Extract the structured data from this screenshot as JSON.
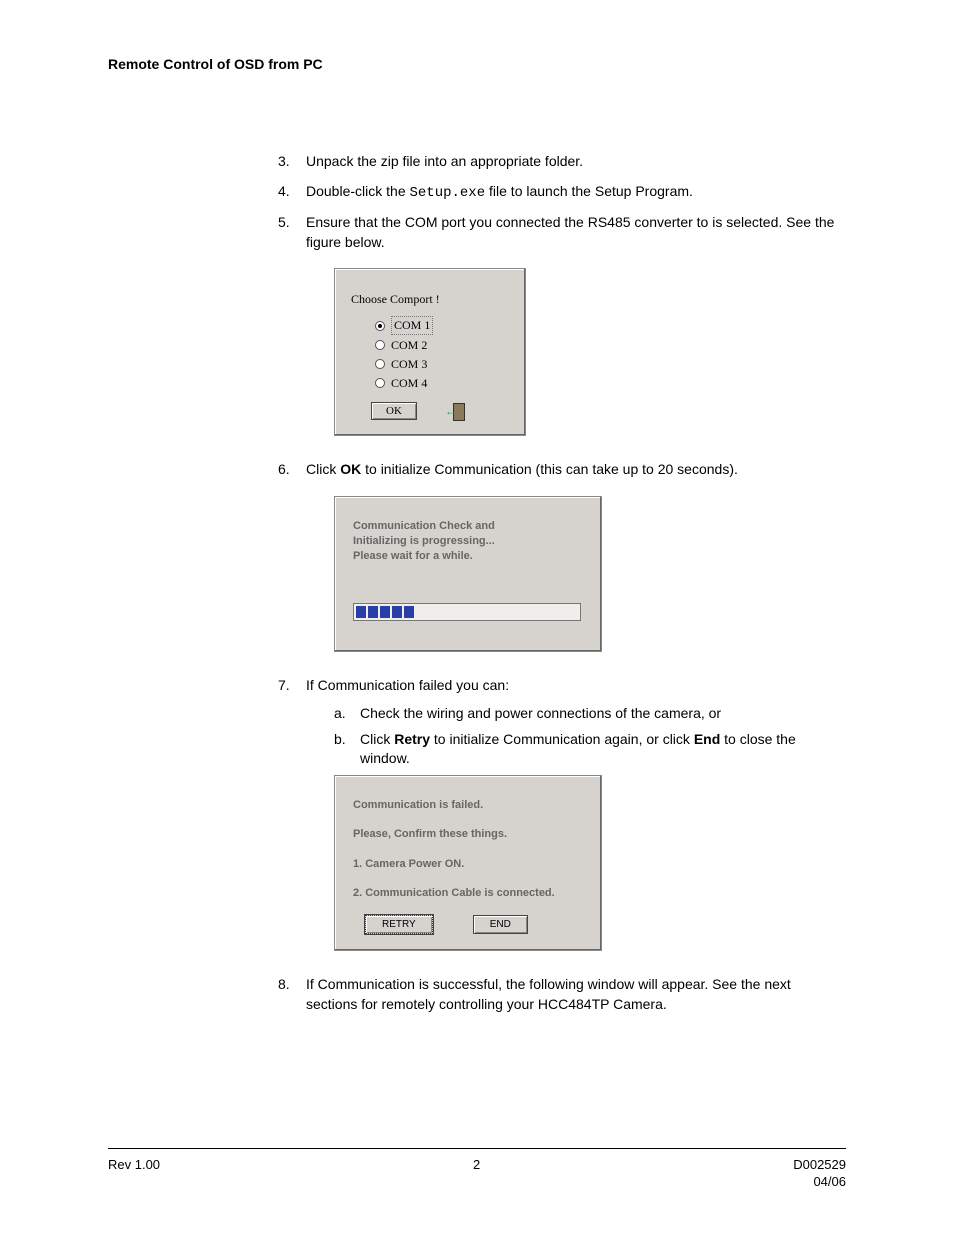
{
  "header": {
    "title": "Remote Control of OSD from PC"
  },
  "steps": {
    "s3": {
      "num": "3.",
      "text": "Unpack the zip file into an appropriate folder."
    },
    "s4": {
      "num": "4.",
      "pre": "Double-click the ",
      "code": "Setup.exe",
      "post": " file to launch the Setup Program."
    },
    "s5": {
      "num": "5.",
      "text": "Ensure that the COM port you connected the RS485 converter to is selected. See the figure below."
    },
    "s6": {
      "num": "6.",
      "pre": "Click ",
      "bold": "OK",
      "post": " to initialize Communication (this can take up to 20 seconds)."
    },
    "s7": {
      "num": "7.",
      "text": "If Communication failed you can:",
      "a": {
        "num": "a.",
        "text": "Check the wiring and power connections of the camera, or"
      },
      "b": {
        "num": "b.",
        "pre": "Click ",
        "bold1": "Retry",
        "mid": " to initialize Communication again, or click ",
        "bold2": "End",
        "post": " to close the window."
      }
    },
    "s8": {
      "num": "8.",
      "text": "If Communication is successful, the following window will appear. See the next sections for remotely controlling your HCC484TP Camera."
    }
  },
  "dialog1": {
    "caption": "Choose Comport !",
    "options": [
      "COM 1",
      "COM 2",
      "COM 3",
      "COM 4"
    ],
    "selected": 0,
    "ok": "OK"
  },
  "dialog2": {
    "line1": "Communication Check and",
    "line2": "Initializing is progressing...",
    "line3": "Please wait for a while.",
    "progress_blocks": 5
  },
  "dialog3": {
    "l1": "Communication is failed.",
    "l2": "Please, Confirm these things.",
    "l3": "1. Camera Power ON.",
    "l4": "2. Communication Cable is connected.",
    "retry": "RETRY",
    "end": "END"
  },
  "footer": {
    "left": "Rev 1.00",
    "center": "2",
    "right1": "D002529",
    "right2": "04/06"
  }
}
